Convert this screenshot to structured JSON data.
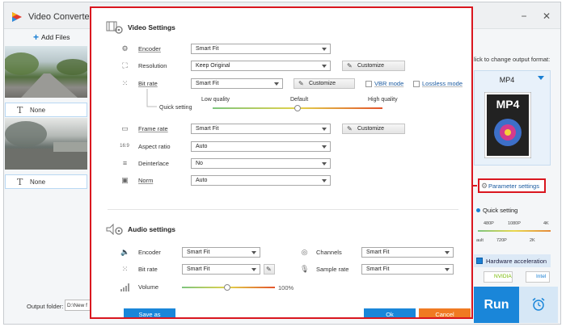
{
  "app": {
    "title": "Video Converter",
    "add_files_label": "Add Files",
    "files": [
      {
        "subtitle_label": "None"
      },
      {
        "subtitle_label": "None"
      }
    ],
    "output_folder_label": "Output folder:",
    "output_folder_value": "D:\\New f",
    "right_panel": {
      "hint": "lick to change output format:",
      "format_name": "MP4",
      "format_icon_text": "MP4",
      "param_settings_label": "Parameter settings",
      "quick_setting_label": "Quick setting",
      "ticks_top": [
        "480P",
        "1080P",
        "4K"
      ],
      "ticks_bottom": [
        "ault",
        "720P",
        "2K"
      ],
      "hw_accel_label": "Hardware acceleration",
      "gpu_nvidia": "NVIDIA",
      "gpu_intel": "Intel",
      "run_label": "Run"
    }
  },
  "dialog": {
    "video_title": "Video Settings",
    "encoder": {
      "label": "Encoder",
      "value": "Smart Fit"
    },
    "resolution": {
      "label": "Resolution",
      "value": "Keep Original",
      "customize": "Customize"
    },
    "bitrate": {
      "label": "Bit rate",
      "value": "Smart Fit",
      "customize": "Customize",
      "vbr": "VBR mode",
      "lossless": "Lossless mode"
    },
    "quick_setting": {
      "label": "Quick setting",
      "low": "Low quality",
      "default": "Default",
      "high": "High quality",
      "level": 0.5
    },
    "framerate": {
      "label": "Frame rate",
      "value": "Smart Fit",
      "customize": "Customize"
    },
    "aspect": {
      "label": "Aspect ratio",
      "value": "Auto"
    },
    "deinterlace": {
      "label": "Deinterlace",
      "value": "No"
    },
    "norm": {
      "label": "Norm",
      "value": "Auto"
    },
    "audio_title": "Audio settings",
    "a_encoder": {
      "label": "Encoder",
      "value": "Smart Fit"
    },
    "a_channels": {
      "label": "Channels",
      "value": "Smart Fit"
    },
    "a_bitrate": {
      "label": "Bit rate",
      "value": "Smart Fit"
    },
    "a_samplerate": {
      "label": "Sample rate",
      "value": "Smart Fit"
    },
    "a_volume": {
      "label": "Volume",
      "value": "100%",
      "level": 0.49
    },
    "save_as": "Save as",
    "ok": "Ok",
    "cancel": "Cancel"
  },
  "colors": {
    "accent": "#1a86d9",
    "highlight": "#d9161f",
    "cancel": "#f07a22"
  }
}
